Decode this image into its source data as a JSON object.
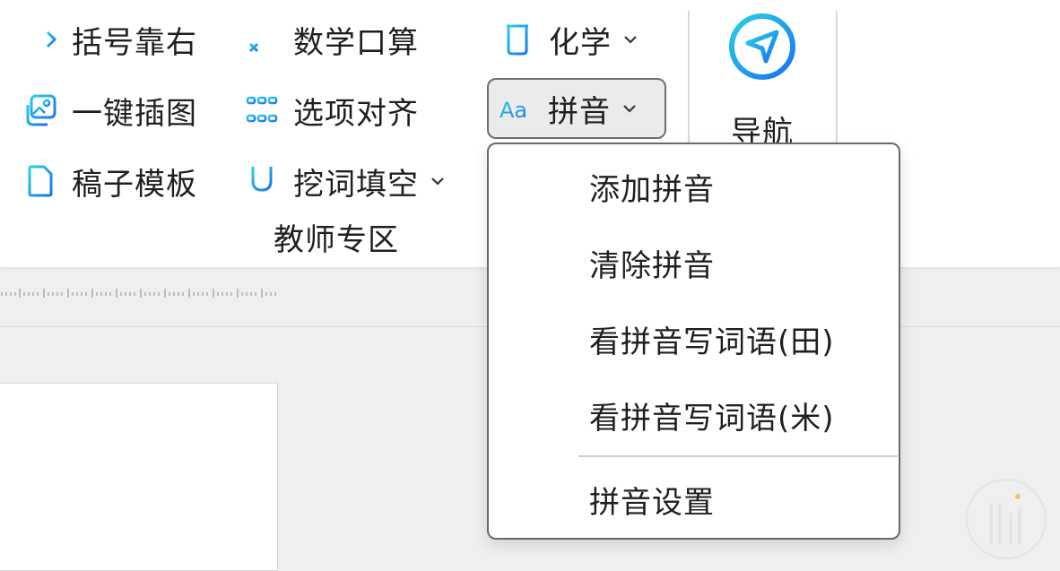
{
  "ribbon": {
    "col1": [
      {
        "label": "括号靠右",
        "icon": "align-right-arrow-icon"
      },
      {
        "label": "一键插图",
        "icon": "insert-image-icon"
      },
      {
        "label": "稿子模板",
        "icon": "document-template-icon"
      }
    ],
    "col2": [
      {
        "label": "数学口算",
        "icon": "math-arithmetic-icon"
      },
      {
        "label": "选项对齐",
        "icon": "options-align-icon"
      },
      {
        "label": "挖词填空",
        "icon": "underline-fill-blank-icon"
      }
    ],
    "col3": [
      {
        "label": "化学",
        "icon": "beaker-icon"
      },
      {
        "label": "拼音",
        "icon": "pinyin-aa-icon"
      }
    ],
    "group_label": "教师专区",
    "nav_label": "导航",
    "accent_color": "#1aa6f0"
  },
  "pinyin_menu": {
    "items": [
      {
        "label": "添加拼音"
      },
      {
        "label": "清除拼音"
      },
      {
        "label": "看拼音写词语(田)"
      },
      {
        "label": "看拼音写词语(米)"
      }
    ],
    "settings_label": "拼音设置"
  },
  "icons": {
    "chevron": "chevron-down-icon",
    "aa_text": "Aa"
  }
}
